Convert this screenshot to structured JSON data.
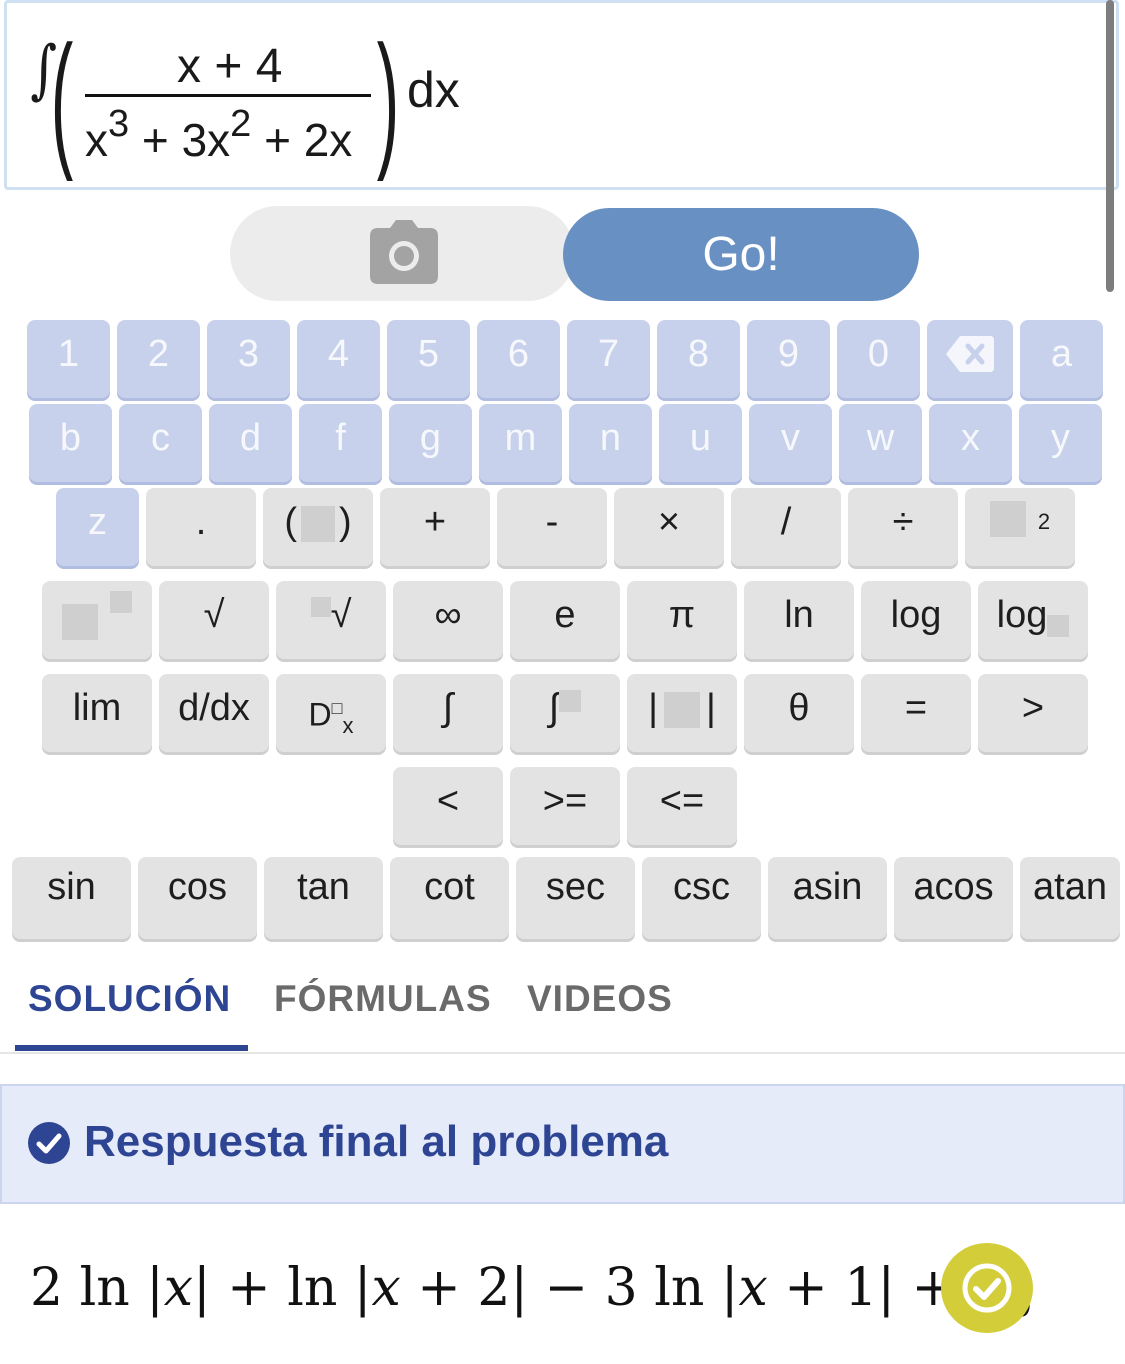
{
  "input": {
    "integral_symbol": "∫",
    "numerator": "x + 4",
    "denominator": {
      "t1_base": "x",
      "t1_exp": "3",
      "t2": " + 3x",
      "t2_exp": "2",
      "t3": " + 2x"
    },
    "differential": "dx"
  },
  "actions": {
    "camera_icon": "camera-icon",
    "go_label": "Go!"
  },
  "keypad": {
    "row1": [
      "1",
      "2",
      "3",
      "4",
      "5",
      "6",
      "7",
      "8",
      "9",
      "0"
    ],
    "backspace_icon": "backspace-icon",
    "row1_end": "a",
    "row2": [
      "b",
      "c",
      "d",
      "f",
      "g",
      "m",
      "n",
      "u",
      "v",
      "w",
      "x",
      "y"
    ],
    "row3": {
      "z": "z",
      "dot": ".",
      "lparen": "(",
      "rparen": ")",
      "plus": "+",
      "minus": "-",
      "times": "×",
      "slash": "/",
      "divide": "÷",
      "sq_exp": "2"
    },
    "row4": {
      "sqrt": "√",
      "nroot_sign": "√",
      "infinity": "∞",
      "e": "e",
      "pi": "π",
      "ln": "ln",
      "log": "log",
      "log_base": "log"
    },
    "row5": {
      "lim": "lim",
      "ddx": "d/dx",
      "deriv_D": "D",
      "deriv_sup": "□",
      "deriv_sub": "x",
      "integral": "∫",
      "def_integral": "∫",
      "abs_l": "|",
      "abs_r": "|",
      "theta": "θ",
      "equals": "=",
      "greater": ">"
    },
    "row6": [
      "<",
      ">=",
      "<="
    ],
    "trig": [
      "sin",
      "cos",
      "tan",
      "cot",
      "sec",
      "csc",
      "asin",
      "acos",
      "atan"
    ]
  },
  "tabs": [
    {
      "label": "SOLUCIÓN",
      "active": true
    },
    {
      "label": "FÓRMULAS",
      "active": false
    },
    {
      "label": "VIDEOS",
      "active": false
    }
  ],
  "answer": {
    "header_icon": "check-circle-icon",
    "title": "Respuesta final al problema",
    "expr": {
      "p1": "2 ln |",
      "v1": "x",
      "p2": "| + ln |",
      "v2": "x",
      "p3": " + 2| − 3 ln |",
      "v3": "x",
      "p4": " + 1| + ",
      "c": "C",
      "c_sub": "0"
    },
    "verify_icon": "check-icon"
  },
  "colors": {
    "accent": "#2e4594",
    "go_button": "#6990c2",
    "blue_key": "#c8d1ec",
    "gray_key": "#e3e3e3",
    "answer_bg": "#e6ebfa",
    "verify": "#d3cd3a"
  }
}
